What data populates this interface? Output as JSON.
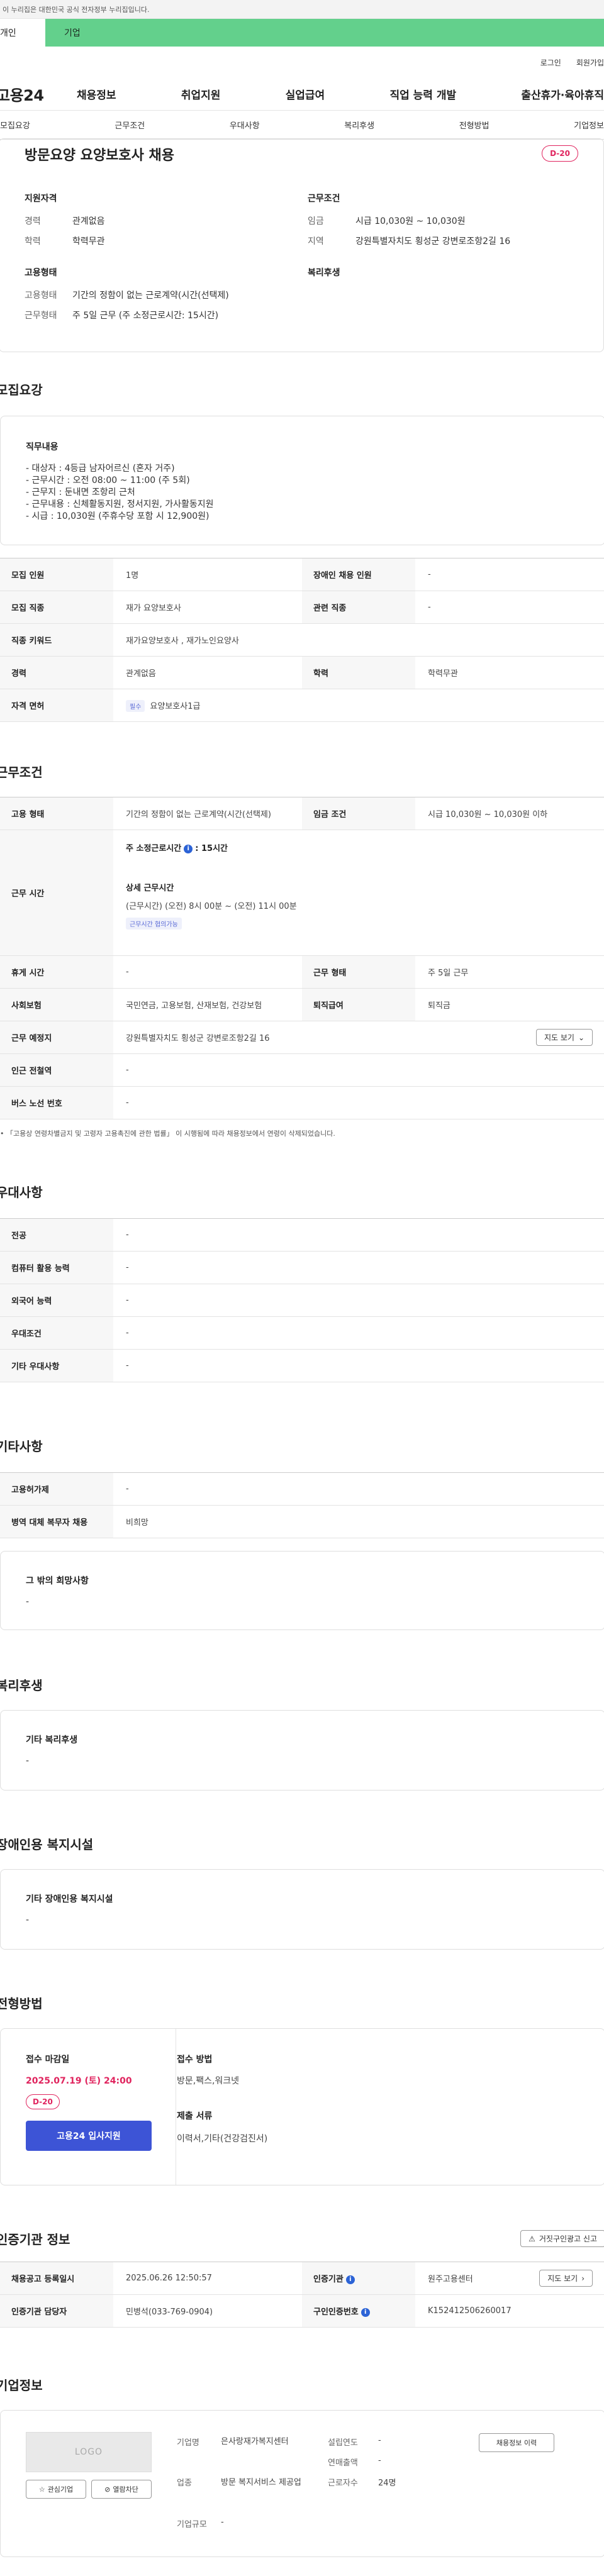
{
  "gov_notice": "이 누리집은 대한민국 공식 전자정부 누리집입니다.",
  "user_tabs": {
    "person": "개인",
    "company": "기업"
  },
  "util": {
    "login": "로그인",
    "join": "회원가입"
  },
  "gnb": {
    "logo": "고용24",
    "menu": [
      "채용정보",
      "취업지원",
      "실업급여",
      "직업 능력 개발",
      "출산휴가·육아휴직"
    ]
  },
  "anchor_tabs": [
    "모집요강",
    "근무조건",
    "우대사항",
    "복리후생",
    "전형방법",
    "기업정보"
  ],
  "summary": {
    "title": "방문요양 요양보호사 채용",
    "dday": "D-20",
    "qual_title": "지원자격",
    "qual": [
      {
        "k": "경력",
        "v": "관계없음"
      },
      {
        "k": "학력",
        "v": "학력무관"
      }
    ],
    "emp_title": "고용형태",
    "emp": [
      {
        "k": "고용형태",
        "v": "기간의 정함이 없는 근로계약(시간(선택제)"
      },
      {
        "k": "근무형태",
        "v": "주 5일 근무 (주 소정근로시간: 15시간)"
      }
    ],
    "work_title": "근무조건",
    "work": [
      {
        "k": "임금",
        "v": "시급 10,030원 ~ 10,030원"
      },
      {
        "k": "지역",
        "v": "강원특별자치도 횡성군 강변로조항2길 16"
      }
    ],
    "welfare_title": "복리후생"
  },
  "recruit": {
    "section": "모집요강",
    "duty_title": "직무내용",
    "duty_lines": [
      "- 대상자 : 4등급 남자어르신 (혼자 거주)",
      "- 근무시간 : 오전 08:00 ~ 11:00 (주 5회)",
      "- 근무지 : 둔내면 조항리 근처",
      "- 근무내용 : 신체활동지원, 정서지원, 가사활동지원",
      "- 시급 : 10,030원 (주휴수당 포함 시 12,900원)"
    ],
    "rows": {
      "headcount_k": "모집 인원",
      "headcount_v": "1명",
      "disabled_k": "장애인 채용 인원",
      "disabled_v": "-",
      "job_k": "모집 직종",
      "job_v": "재가 요양보호사",
      "related_k": "관련 직종",
      "related_v": "-",
      "keyword_k": "직종 키워드",
      "keyword_v": "재가요양보호사 , 재가노인요양사",
      "career_k": "경력",
      "career_v": "관계없음",
      "edu_k": "학력",
      "edu_v": "학력무관",
      "license_k": "자격 면허",
      "license_tag": "필수",
      "license_v": "요양보호사1급"
    }
  },
  "work": {
    "section": "근무조건",
    "type_k": "고용 형태",
    "type_v": "기간의 정함이 없는 근로계약(시간(선택제)",
    "wage_k": "임금 조건",
    "wage_v": "시급 10,030원 ~ 10,030원 이하",
    "time_k": "근무 시간",
    "time_total_label": "주 소정근로시간",
    "time_total_value": ": 15시간",
    "time_detail_label": "상세 근무시간",
    "time_detail_value": "(근무시간) (오전) 8시 00분 ~ (오전) 11시 00분",
    "time_tag": "근무시간 협의가능",
    "rest_k": "휴게 시간",
    "rest_v": "-",
    "worktype_k": "근무 형태",
    "worktype_v": "주 5일 근무",
    "ins_k": "사회보험",
    "ins_v": "국민연금, 고용보험, 산재보험, 건강보험",
    "retire_k": "퇴직급여",
    "retire_v": "퇴직금",
    "place_k": "근무 예정지",
    "place_v": "강원특별자치도 횡성군 강변로조항2길 16",
    "map_btn": "지도 보기",
    "subway_k": "인근 전철역",
    "subway_v": "-",
    "bus_k": "버스 노선 번호",
    "bus_v": "-",
    "note": "「고용상 연령차별금지 및 고령자 고용촉진에 관한 법률」 이 시행됨에 따라 채용정보에서 연령이 삭제되었습니다."
  },
  "pref": {
    "section": "우대사항",
    "rows": [
      {
        "k": "전공",
        "v": "-"
      },
      {
        "k": "컴퓨터 활용 능력",
        "v": "-"
      },
      {
        "k": "외국어 능력",
        "v": "-"
      },
      {
        "k": "우대조건",
        "v": "-"
      },
      {
        "k": "기타 우대사항",
        "v": "-"
      }
    ]
  },
  "etc": {
    "section": "기타사항",
    "rows": [
      {
        "k": "고용허가제",
        "v": "-"
      },
      {
        "k": "병역 대체 복무자 채용",
        "v": "비희망"
      }
    ],
    "other_title": "그 밖의 희망사항",
    "other_v": "-"
  },
  "welfare": {
    "section": "복리후생",
    "title": "기타 복리후생",
    "v": "-"
  },
  "disabled_fac": {
    "section": "장애인용 복지시설",
    "title": "기타 장애인용 복지시설",
    "v": "-"
  },
  "apply": {
    "section": "전형방법",
    "deadline_title": "접수 마감일",
    "deadline": "2025.07.19 (토) 24:00",
    "dday": "D-20",
    "button": "고용24 입사지원",
    "method_title": "접수 방법",
    "method": "방문,팩스,워크넷",
    "docs_title": "제출 서류",
    "docs": "이력서,기타(건강검진서)"
  },
  "cert": {
    "section": "인증기관 정보",
    "report_btn": "거짓구인광고 신고",
    "reg_k": "채용공고 등록일시",
    "reg_v": "2025.06.26 12:50:57",
    "org_k": "인증기관",
    "org_v": "원주고용센터",
    "map_btn": "지도 보기",
    "staff_k": "인증기관 담당자",
    "staff_v": "민병석(033-769-0904)",
    "certno_k": "구인인증번호",
    "certno_v": "K152412506260017"
  },
  "company": {
    "section": "기업정보",
    "logo": "LOGO",
    "fav_btn": "관심기업",
    "block_btn": "열람차단",
    "name_k": "기업명",
    "name_v": "은사랑재가복지센터",
    "ind_k": "업종",
    "ind_v": "방문 복지서비스 제공업",
    "size_k": "기업규모",
    "size_v": "-",
    "est_k": "설립연도",
    "est_v": "-",
    "sales_k": "연매출액",
    "sales_v": "-",
    "emp_k": "근로자수",
    "emp_v": "24명",
    "hist_btn": "채용정보 이력"
  }
}
